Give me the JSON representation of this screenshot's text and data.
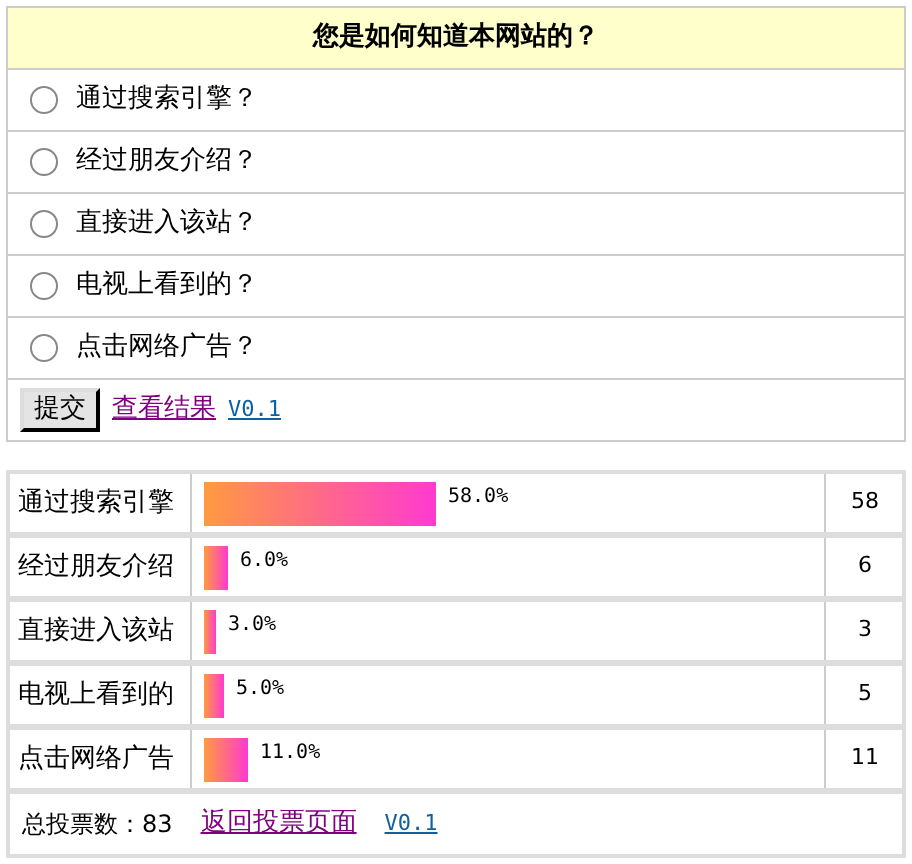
{
  "poll": {
    "title": "您是如何知道本网站的？",
    "options": [
      {
        "label": "通过搜索引擎？",
        "selected": false
      },
      {
        "label": "经过朋友介绍？",
        "selected": false
      },
      {
        "label": "直接进入该站？",
        "selected": false
      },
      {
        "label": "电视上看到的？",
        "selected": false
      },
      {
        "label": "点击网络广告？",
        "selected": false
      }
    ],
    "submit": "提交",
    "results_link": "查看结果",
    "version_link": "V0.1"
  },
  "results": {
    "rows": [
      {
        "label": "通过搜索引擎",
        "percent": "58.0%",
        "count": "58"
      },
      {
        "label": "经过朋友介绍",
        "percent": "6.0%",
        "count": "6"
      },
      {
        "label": "直接进入该站",
        "percent": "3.0%",
        "count": "3"
      },
      {
        "label": "电视上看到的",
        "percent": "5.0%",
        "count": "5"
      },
      {
        "label": "点击网络广告",
        "percent": "11.0%",
        "count": "11"
      }
    ],
    "total": "总投票数：83",
    "back_link": "返回投票页面",
    "version_link": "V0.1"
  }
}
